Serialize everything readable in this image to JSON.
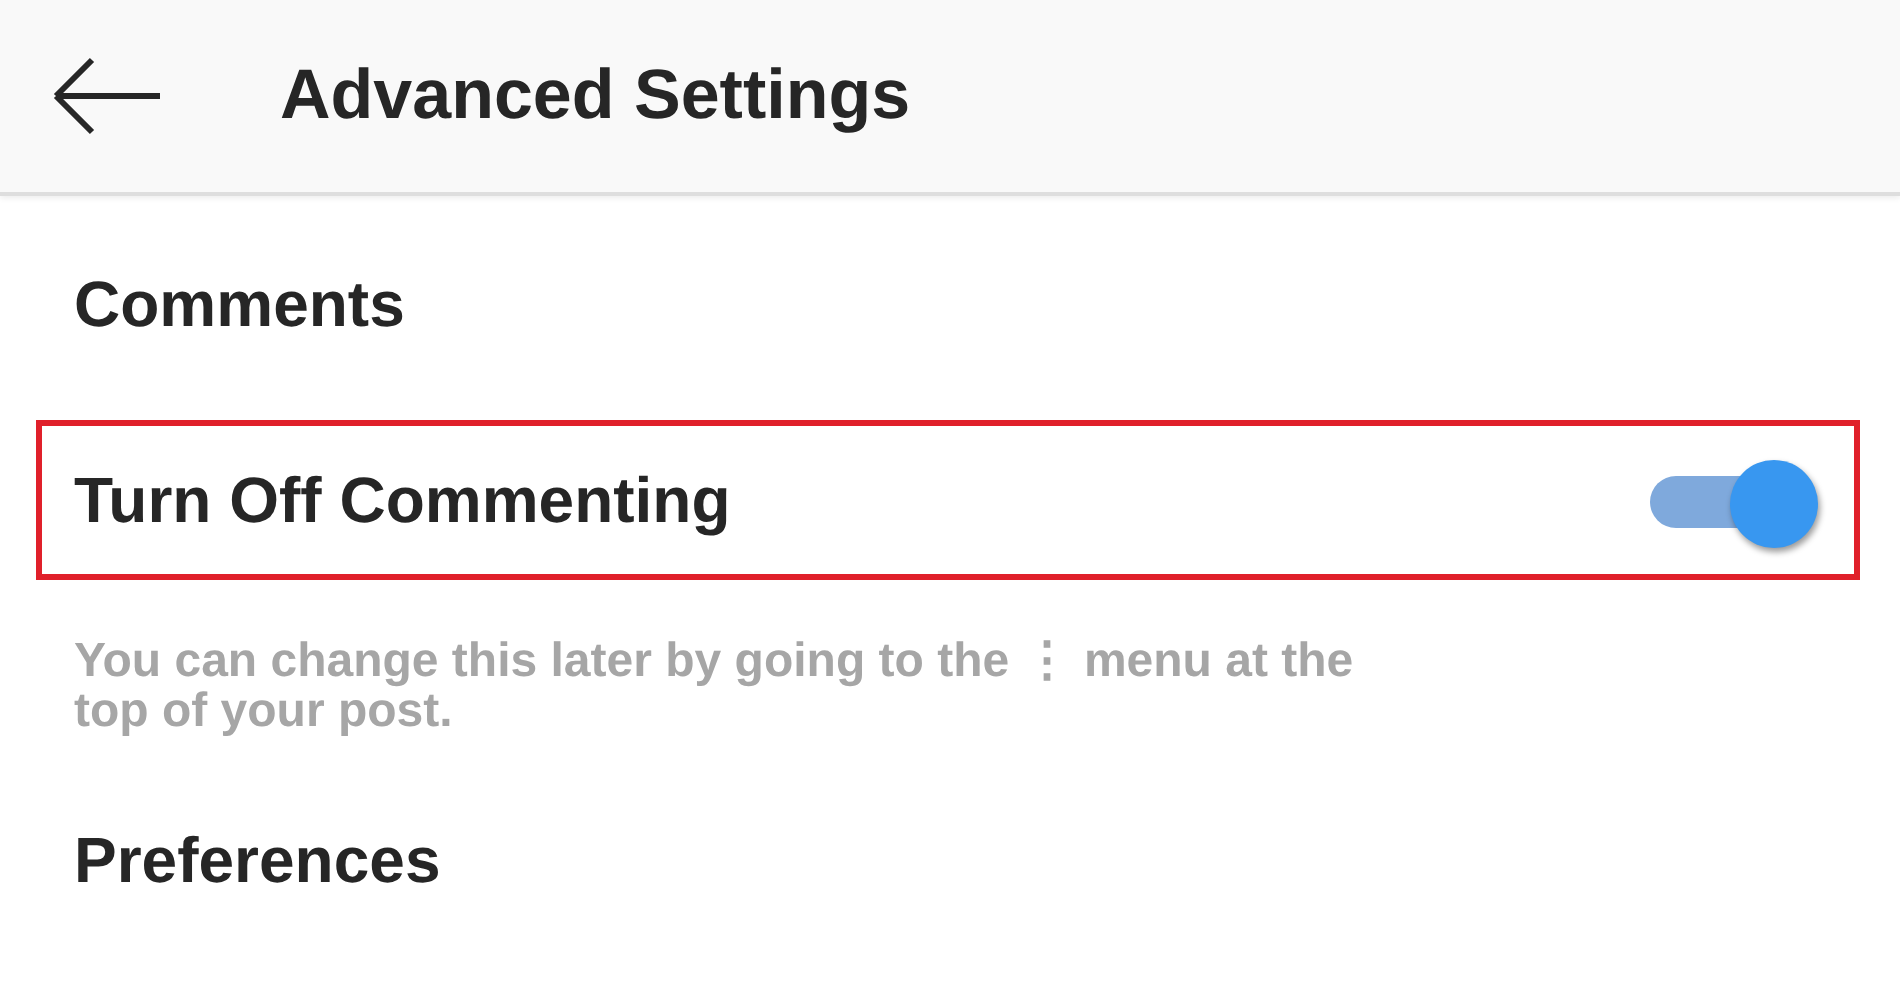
{
  "header": {
    "title": "Advanced Settings"
  },
  "sections": [
    {
      "kind": "heading",
      "text": "Comments"
    },
    {
      "kind": "toggle",
      "label": "Turn Off Commenting",
      "on": true,
      "highlighted": true
    },
    {
      "kind": "note",
      "text": "You can change this later by going to the ⋮ menu at the top of your post."
    },
    {
      "kind": "heading",
      "text": "Preferences"
    }
  ]
}
